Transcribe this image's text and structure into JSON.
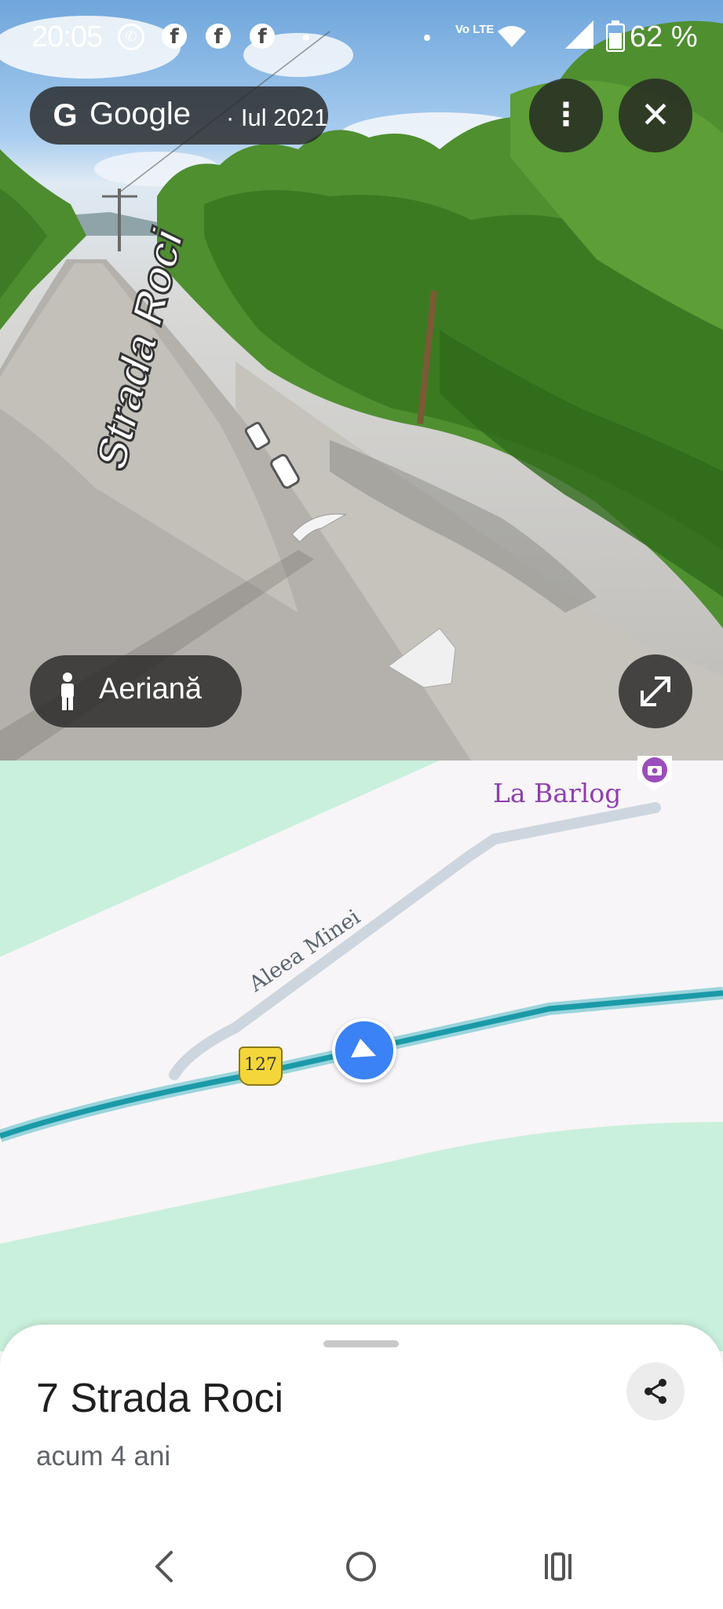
{
  "status_bar": {
    "time": "20:05",
    "lte_label": "Vo LTE",
    "battery": "62 %"
  },
  "streetview": {
    "provider": "Google",
    "capture_date": "· Iul 2021",
    "aerial_label": "Aeriană",
    "road_label": "Strada Roci"
  },
  "map": {
    "poi_name": "La Barlog",
    "street_name": "Aleea Minei",
    "route_number": "127",
    "colors": {
      "route": "#1a9aa8",
      "park": "#c8f0dc",
      "road": "#f7f5f7"
    }
  },
  "sheet": {
    "title": "7 Strada Roci",
    "subtitle": "acum 4 ani"
  },
  "icons": {
    "google": "G",
    "more": "⋮",
    "close": "✕"
  }
}
